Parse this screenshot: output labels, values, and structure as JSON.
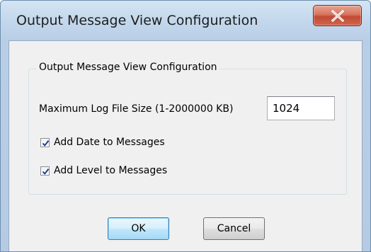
{
  "window": {
    "title": "Output Message View Configuration"
  },
  "group": {
    "title": "Output Message View Configuration"
  },
  "log_size": {
    "label": "Maximum Log File Size (1-2000000 KB)",
    "value": "1024"
  },
  "options": [
    {
      "label": "Add Date to Messages",
      "checked": true
    },
    {
      "label": "Add Level to Messages",
      "checked": true
    }
  ],
  "buttons": {
    "ok": "OK",
    "cancel": "Cancel"
  },
  "icons": {
    "close": "close-icon",
    "check": "checkmark-icon"
  },
  "colors": {
    "close_button": "#c75a43",
    "client_bg": "#f0f0f0",
    "default_button_border": "#3c7fb1"
  }
}
